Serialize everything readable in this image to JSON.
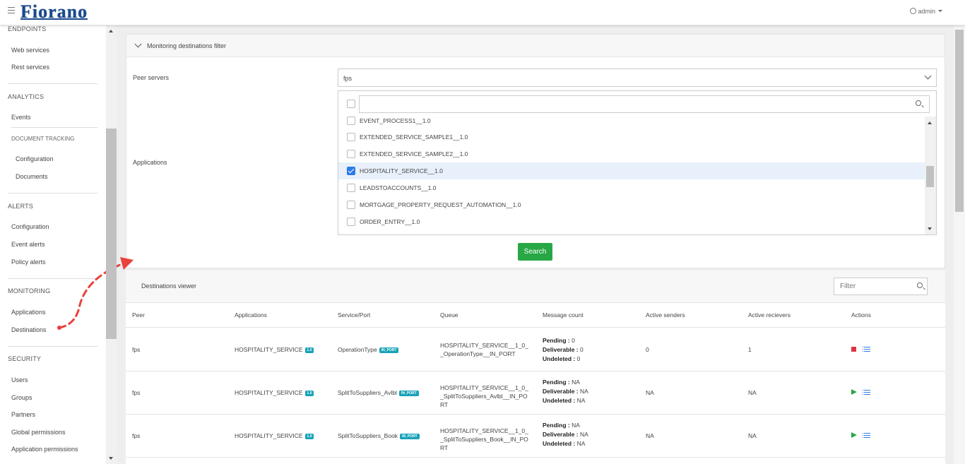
{
  "app": {
    "logo": "Fiorano",
    "user": "admin"
  },
  "sidebar": {
    "endpoints": {
      "heading": "ENDPOINTS",
      "items": [
        "Web services",
        "Rest services"
      ]
    },
    "analytics": {
      "heading": "ANALYTICS",
      "items": [
        "Events"
      ],
      "doc_tracking": "DOCUMENT TRACKING",
      "doc_items": [
        "Configuration",
        "Documents"
      ]
    },
    "alerts": {
      "heading": "ALERTS",
      "items": [
        "Configuration",
        "Event alerts",
        "Policy alerts"
      ]
    },
    "monitoring": {
      "heading": "MONITORING",
      "items": [
        "Applications",
        "Destinations"
      ]
    },
    "security": {
      "heading": "SECURITY",
      "items": [
        "Users",
        "Groups",
        "Partners",
        "Global permissions",
        "Application permissions"
      ]
    }
  },
  "filter_panel": {
    "title": "Monitoring destinations filter",
    "peer_servers_label": "Peer servers",
    "peer_server_value": "fps",
    "applications_label": "Applications",
    "app_search_placeholder": "",
    "applications": [
      {
        "name": "EVENT_PROCESS1__1.0",
        "checked": false
      },
      {
        "name": "EXTENDED_SERVICE_SAMPLE1__1.0",
        "checked": false
      },
      {
        "name": "EXTENDED_SERVICE_SAMPLE2__1.0",
        "checked": false
      },
      {
        "name": "HOSPITALITY_SERVICE__1.0",
        "checked": true
      },
      {
        "name": "LEADSTOACCOUNTS__1.0",
        "checked": false
      },
      {
        "name": "MORTGAGE_PROPERTY_REQUEST_AUTOMATION__1.0",
        "checked": false
      },
      {
        "name": "ORDER_ENTRY__1.0",
        "checked": false
      }
    ],
    "search_button": "Search"
  },
  "viewer": {
    "title": "Destinations viewer",
    "filter_placeholder": "Filter",
    "columns": [
      "Peer",
      "Applications",
      "Service/Port",
      "Queue",
      "Message count",
      "Active senders",
      "Active recievers",
      "Actions"
    ],
    "rows": [
      {
        "peer": "fps",
        "application": "HOSPITALITY_SERVICE",
        "app_version": "1.0",
        "service": "OperationType",
        "port_badge": "IN_PORT",
        "queue": "HOSPITALITY_SERVICE__1_0__OperationType__IN_PORT",
        "pending_label": "Pending :",
        "pending": "0",
        "deliverable_label": "Deliverable :",
        "deliverable": "0",
        "undeleted_label": "Undeleted :",
        "undeleted": "0",
        "senders": "0",
        "receivers": "1",
        "action": "stop"
      },
      {
        "peer": "fps",
        "application": "HOSPITALITY_SERVICE",
        "app_version": "1.0",
        "service": "SplitToSuppliers_Avlbl",
        "port_badge": "IN_PORT",
        "queue": "HOSPITALITY_SERVICE__1_0__SplitToSuppliers_Avlbl__IN_PORT",
        "pending_label": "Pending :",
        "pending": "NA",
        "deliverable_label": "Deliverable :",
        "deliverable": "NA",
        "undeleted_label": "Undeleted :",
        "undeleted": "NA",
        "senders": "NA",
        "receivers": "NA",
        "action": "play"
      },
      {
        "peer": "fps",
        "application": "HOSPITALITY_SERVICE",
        "app_version": "1.0",
        "service": "SplitToSuppliers_Book",
        "port_badge": "IN_PORT",
        "queue": "HOSPITALITY_SERVICE__1_0__SplitToSuppliers_Book__IN_PORT",
        "pending_label": "Pending :",
        "pending": "NA",
        "deliverable_label": "Deliverable :",
        "deliverable": "NA",
        "undeleted_label": "Undeleted :",
        "undeleted": "NA",
        "senders": "NA",
        "receivers": "NA",
        "action": "play"
      }
    ]
  },
  "colors": {
    "brand": "#1b4a8c",
    "accent": "#2c7be5",
    "success": "#28a745",
    "danger": "#dc3545",
    "badge": "#17a2b8",
    "annotation": "#e8433a"
  }
}
